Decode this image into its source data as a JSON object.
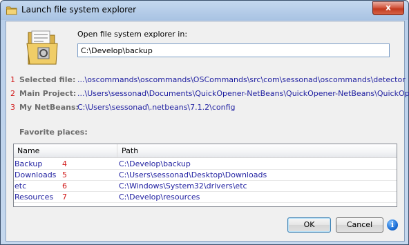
{
  "window": {
    "title": "Launch file system explorer",
    "close_symbol": "x"
  },
  "dialog": {
    "prompt": "Open file system explorer in:",
    "path_value": "C:\\Develop\\backup"
  },
  "info": [
    {
      "num": "1",
      "label": "Selected file:",
      "value": "...\\oscommands\\oscommands\\OSCommands\\src\\com\\sessonad\\oscommands\\detector"
    },
    {
      "num": "2",
      "label": "Main Project:",
      "value": "...\\Users\\sessonad\\Documents\\QuickOpener-NetBeans\\QuickOpener-NetBeans\\QuickOpener"
    },
    {
      "num": "3",
      "label": "My NetBeans:",
      "value": "C:\\Users\\sessonad\\.netbeans\\7.1.2\\config"
    }
  ],
  "favorites": {
    "label": "Favorite places:",
    "columns": {
      "name": "Name",
      "path": "Path"
    },
    "rows": [
      {
        "name": "Backup",
        "num": "4",
        "path": "C:\\Develop\\backup"
      },
      {
        "name": "Downloads",
        "num": "5",
        "path": "C:\\Users\\sessonad\\Desktop\\Downloads"
      },
      {
        "name": "etc",
        "num": "6",
        "path": "C:\\Windows\\System32\\drivers\\etc"
      },
      {
        "name": "Resources",
        "num": "7",
        "path": "C:\\Develop\\resources"
      }
    ]
  },
  "buttons": {
    "ok": "OK",
    "cancel": "Cancel",
    "help_symbol": "i"
  },
  "colors": {
    "link": "#1e1ea0",
    "number": "#d11a1a",
    "label": "#6d6d6d"
  },
  "icons": {
    "title": "folder-icon",
    "main": "folder-documents-icon",
    "help": "info-icon"
  }
}
